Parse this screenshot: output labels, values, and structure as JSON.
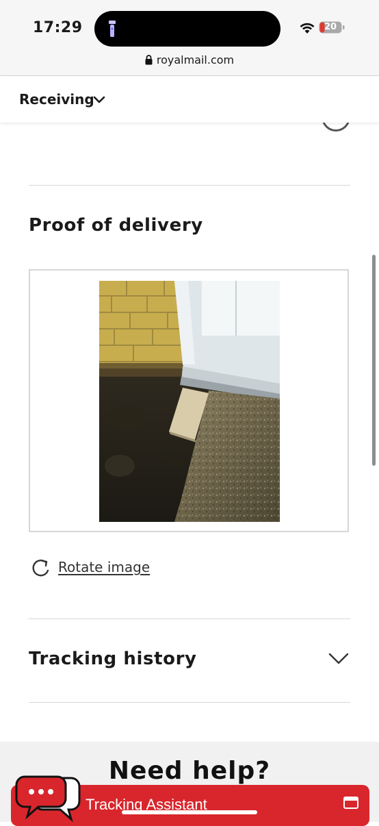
{
  "status_bar": {
    "time": "17:29",
    "battery_level": "20",
    "url": "royalmail.com"
  },
  "nav": {
    "section_label": "Receiving"
  },
  "proof": {
    "title": "Proof of delivery",
    "rotate_label": "Rotate image"
  },
  "history": {
    "title": "Tracking history"
  },
  "help": {
    "title": "Need help?",
    "assistant_label": "Tracking Assistant"
  },
  "colors": {
    "brand_red": "#d8262c",
    "text": "#1a1a1a"
  },
  "icons": [
    "lock-icon",
    "chevron-down-icon",
    "rotate-icon",
    "chat-bubbles-icon",
    "expand-window-icon",
    "wifi-icon",
    "battery-icon",
    "flashlight-icon"
  ]
}
